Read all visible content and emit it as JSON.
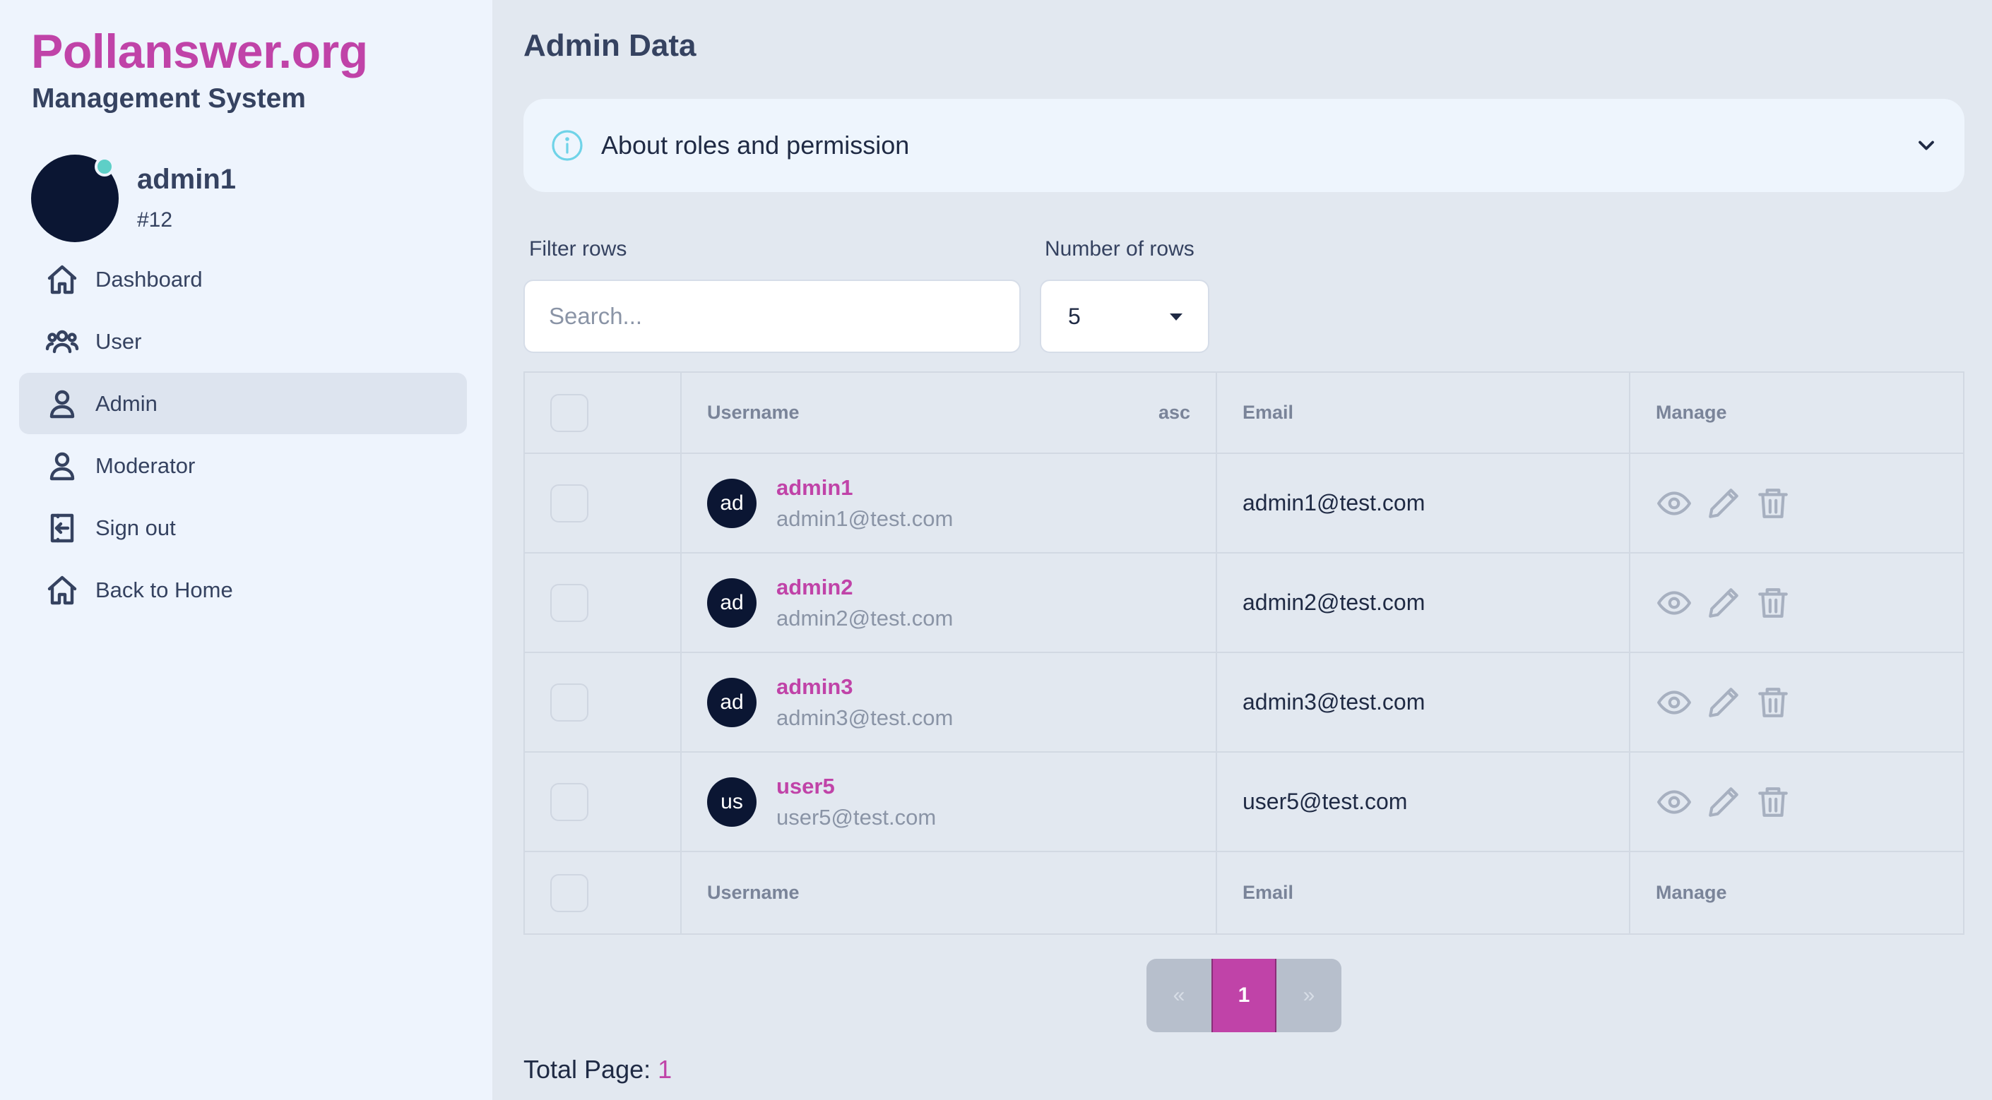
{
  "sidebar": {
    "brand": "Pollanswer.org",
    "subtitle": "Management System",
    "profile": {
      "name": "admin1",
      "id": "#12"
    },
    "items": [
      {
        "label": "Dashboard",
        "icon": "home-icon"
      },
      {
        "label": "User",
        "icon": "users-icon"
      },
      {
        "label": "Admin",
        "icon": "user-icon",
        "active": true
      },
      {
        "label": "Moderator",
        "icon": "user-icon"
      },
      {
        "label": "Sign out",
        "icon": "sign-out-icon"
      },
      {
        "label": "Back to Home",
        "icon": "home-icon"
      }
    ]
  },
  "main": {
    "title": "Admin Data",
    "accordion": {
      "label": "About roles and permission"
    },
    "filter": {
      "label": "Filter rows",
      "placeholder": "Search..."
    },
    "rows_select": {
      "label": "Number of rows",
      "value": "5"
    },
    "table": {
      "headers": {
        "username": "Username",
        "sort": "asc",
        "email": "Email",
        "manage": "Manage"
      },
      "rows": [
        {
          "initials": "ad",
          "username": "admin1",
          "sub_email": "admin1@test.com",
          "email": "admin1@test.com"
        },
        {
          "initials": "ad",
          "username": "admin2",
          "sub_email": "admin2@test.com",
          "email": "admin2@test.com"
        },
        {
          "initials": "ad",
          "username": "admin3",
          "sub_email": "admin3@test.com",
          "email": "admin3@test.com"
        },
        {
          "initials": "us",
          "username": "user5",
          "sub_email": "user5@test.com",
          "email": "user5@test.com"
        }
      ]
    },
    "pagination": {
      "prev": "«",
      "current": "1",
      "next": "»"
    },
    "total_page": {
      "label": "Total Page:",
      "value": "1"
    }
  },
  "colors": {
    "accent": "#c043a8",
    "avatar": "#0b1633",
    "online": "#5ecfc7",
    "sidebar_bg": "#eef4fd",
    "main_bg": "#e2e8f0"
  }
}
